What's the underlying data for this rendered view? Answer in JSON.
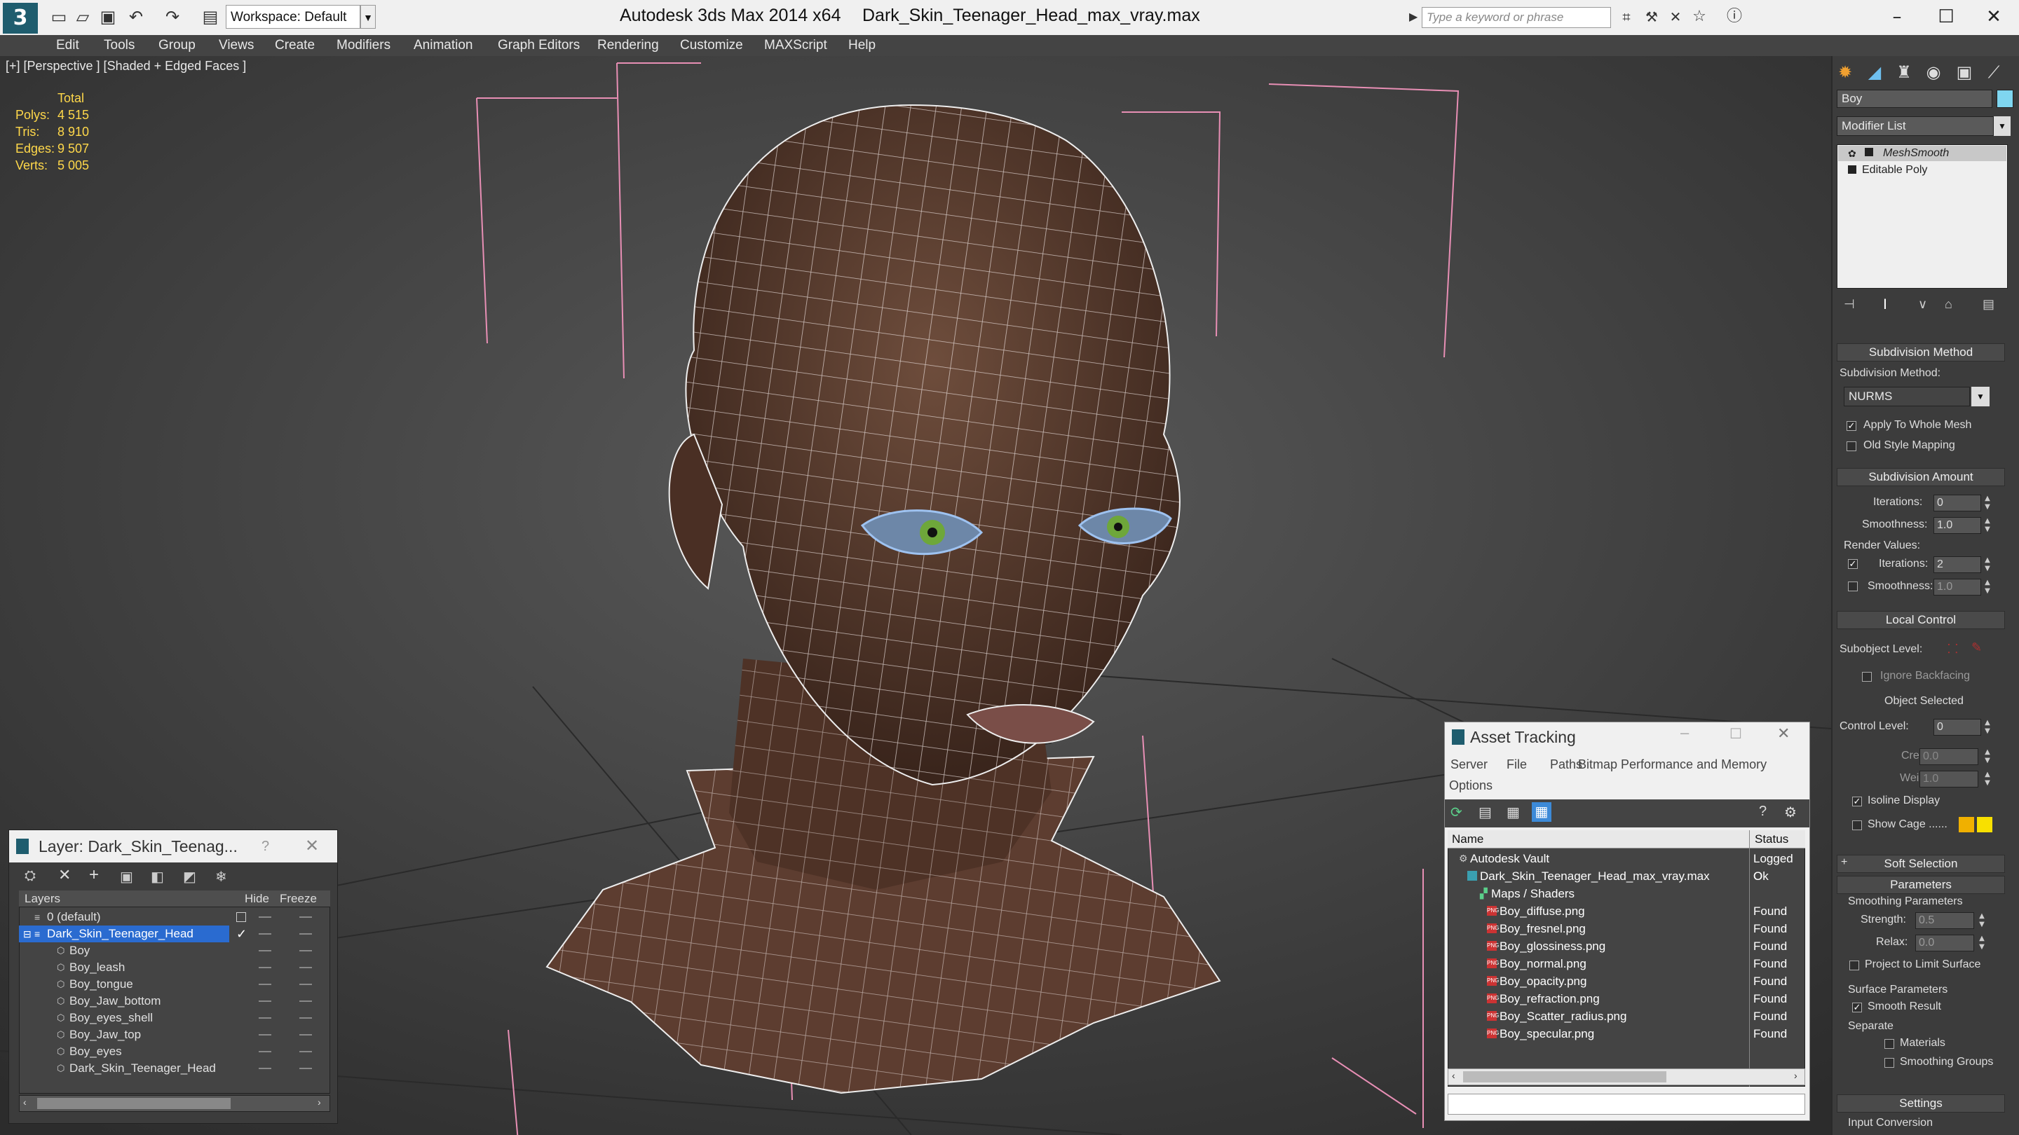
{
  "titlebar": {
    "logo": "3",
    "workspace_label": "Workspace: Default",
    "app_title": "Autodesk 3ds Max  2014 x64",
    "file_title": "Dark_Skin_Teenager_Head_max_vray.max",
    "search_placeholder": "Type a keyword or phrase",
    "icons": [
      "new-file-icon",
      "open-file-icon",
      "save-icon",
      "undo-icon",
      "redo-icon",
      "project-folder-icon"
    ],
    "window_controls": [
      "minimize-icon",
      "maximize-icon",
      "close-icon"
    ]
  },
  "menu": [
    "Edit",
    "Tools",
    "Group",
    "Views",
    "Create",
    "Modifiers",
    "Animation",
    "Graph Editors",
    "Rendering",
    "Customize",
    "MAXScript",
    "Help"
  ],
  "viewport": {
    "label": "[+] [Perspective ] [Shaded + Edged Faces ]",
    "stats_header": "Total",
    "stats": [
      {
        "label": "Polys:",
        "value": "4 515"
      },
      {
        "label": "Tris:",
        "value": "8 910"
      },
      {
        "label": "Edges:",
        "value": "9 507"
      },
      {
        "label": "Verts:",
        "value": "5 005"
      }
    ]
  },
  "command_panel": {
    "object_name": "Boy",
    "object_color": "#7fd6f0",
    "modifier_list_label": "Modifier List",
    "stack": [
      "MeshSmooth",
      "Editable Poly"
    ],
    "rollouts": {
      "subdivision_method": {
        "title": "Subdivision Method",
        "method_label": "Subdivision Method:",
        "method_value": "NURMS",
        "apply_whole_mesh": "Apply To Whole Mesh",
        "old_style_mapping": "Old Style Mapping"
      },
      "subdivision_amount": {
        "title": "Subdivision Amount",
        "iterations_label": "Iterations:",
        "iterations_value": "0",
        "smoothness_label": "Smoothness:",
        "smoothness_value": "1.0",
        "render_values_label": "Render Values:",
        "render_iterations_label": "Iterations:",
        "render_iterations_value": "2",
        "render_smoothness_label": "Smoothness:",
        "render_smoothness_value": "1.0"
      },
      "local_control": {
        "title": "Local Control",
        "subobject_label": "Subobject Level:",
        "ignore_backfacing": "Ignore Backfacing",
        "object_selected": "Object Selected",
        "control_level_label": "Control Level:",
        "control_level_value": "0",
        "crease_label": "Crease:",
        "crease_value": "0.0",
        "weight_label": "Weight:",
        "weight_value": "1.0",
        "isoline_display": "Isoline Display",
        "show_cage": "Show Cage ......"
      },
      "soft_selection": {
        "title": "Soft Selection"
      },
      "parameters": {
        "title": "Parameters",
        "smoothing_params": "Smoothing Parameters",
        "strength_label": "Strength:",
        "strength_value": "0.5",
        "relax_label": "Relax:",
        "relax_value": "0.0",
        "project_limit": "Project to Limit Surface",
        "surface_params": "Surface Parameters",
        "smooth_result": "Smooth Result",
        "separate": "Separate",
        "materials": "Materials",
        "smoothing_groups": "Smoothing Groups"
      },
      "settings": {
        "title": "Settings",
        "input_conversion": "Input Conversion"
      }
    }
  },
  "layer_dialog": {
    "title": "Layer: Dark_Skin_Teenag...",
    "help": "?",
    "columns": {
      "layers": "Layers",
      "hide": "Hide",
      "freeze": "Freeze"
    },
    "rows": [
      {
        "name": "0 (default)",
        "indent": 1,
        "selected": false
      },
      {
        "name": "Dark_Skin_Teenager_Head",
        "indent": 1,
        "selected": true
      },
      {
        "name": "Boy",
        "indent": 2,
        "selected": false
      },
      {
        "name": "Boy_leash",
        "indent": 2,
        "selected": false
      },
      {
        "name": "Boy_tongue",
        "indent": 2,
        "selected": false
      },
      {
        "name": "Boy_Jaw_bottom",
        "indent": 2,
        "selected": false
      },
      {
        "name": "Boy_eyes_shell",
        "indent": 2,
        "selected": false
      },
      {
        "name": "Boy_Jaw_top",
        "indent": 2,
        "selected": false
      },
      {
        "name": "Boy_eyes",
        "indent": 2,
        "selected": false
      },
      {
        "name": "Dark_Skin_Teenager_Head",
        "indent": 2,
        "selected": false
      }
    ]
  },
  "asset_dialog": {
    "title": "Asset Tracking",
    "menu": [
      "Server",
      "File",
      "Paths",
      "Bitmap Performance and Memory",
      "Options"
    ],
    "columns": {
      "name": "Name",
      "status": "Status"
    },
    "rows": [
      {
        "name": "Autodesk Vault",
        "status": "Logged O",
        "level": 0
      },
      {
        "name": "Dark_Skin_Teenager_Head_max_vray.max",
        "status": "Ok",
        "level": 1
      },
      {
        "name": "Maps / Shaders",
        "status": "",
        "level": 2
      },
      {
        "name": "Boy_diffuse.png",
        "status": "Found",
        "level": 3
      },
      {
        "name": "Boy_fresnel.png",
        "status": "Found",
        "level": 3
      },
      {
        "name": "Boy_glossiness.png",
        "status": "Found",
        "level": 3
      },
      {
        "name": "Boy_normal.png",
        "status": "Found",
        "level": 3
      },
      {
        "name": "Boy_opacity.png",
        "status": "Found",
        "level": 3
      },
      {
        "name": "Boy_refraction.png",
        "status": "Found",
        "level": 3
      },
      {
        "name": "Boy_Scatter_radius.png",
        "status": "Found",
        "level": 3
      },
      {
        "name": "Boy_specular.png",
        "status": "Found",
        "level": 3
      }
    ]
  }
}
